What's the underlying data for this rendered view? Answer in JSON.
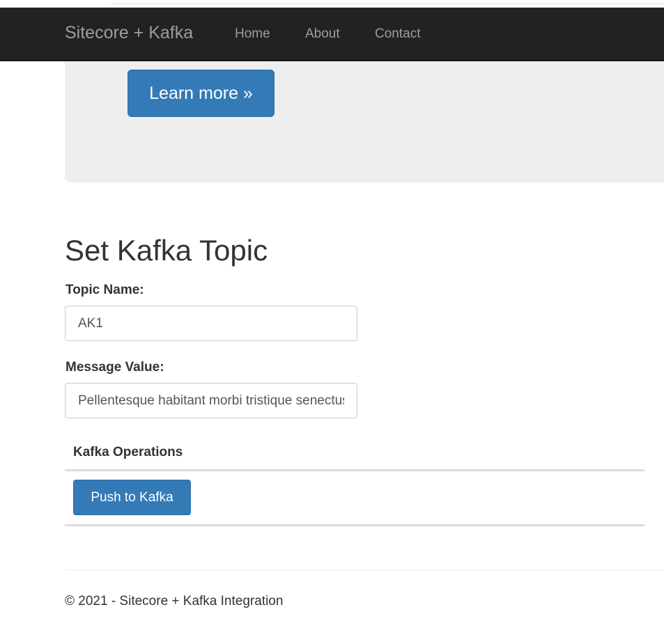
{
  "navbar": {
    "brand": "Sitecore + Kafka",
    "links": [
      {
        "label": "Home"
      },
      {
        "label": "About"
      },
      {
        "label": "Contact"
      }
    ]
  },
  "jumbotron": {
    "learn_more_label": "Learn more »"
  },
  "form": {
    "title": "Set Kafka Topic",
    "topic_label": "Topic Name:",
    "topic_value": "AK1",
    "message_label": "Message Value:",
    "message_value": "Pellentesque habitant morbi tristique senectus"
  },
  "operations": {
    "header": "Kafka Operations",
    "push_label": "Push to Kafka"
  },
  "footer": {
    "text": "© 2021 - Sitecore + Kafka Integration"
  },
  "colors": {
    "navbar_bg": "#222222",
    "nav_text": "#9d9d9d",
    "primary": "#337ab7",
    "jumbotron_bg": "#eeeeee"
  }
}
